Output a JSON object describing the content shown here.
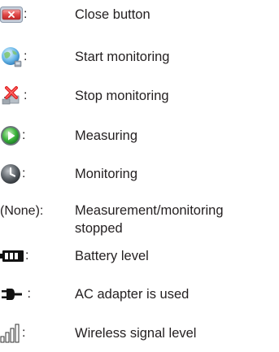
{
  "legend": {
    "items": [
      {
        "icon": "close-button-icon",
        "colon": ":",
        "label": "Close button"
      },
      {
        "icon": "globe-start-monitoring-icon",
        "colon": ":",
        "label": "Start monitoring"
      },
      {
        "icon": "stop-monitoring-icon",
        "colon": ":",
        "label": "Stop monitoring"
      },
      {
        "icon": "measuring-play-icon",
        "colon": ":",
        "label": "Measuring"
      },
      {
        "icon": "monitoring-clock-icon",
        "colon": ":",
        "label": "Monitoring"
      },
      {
        "icon": "none",
        "prefix": "(None):",
        "label_line1": "Measurement/monitoring",
        "label_line2": "stopped"
      },
      {
        "icon": "battery-icon",
        "colon": ":",
        "label": "Battery level"
      },
      {
        "icon": "ac-plug-icon",
        "colon": " :",
        "label": "AC adapter is used"
      },
      {
        "icon": "wireless-signal-icon",
        "colon": ":",
        "label": "Wireless signal level"
      }
    ]
  }
}
